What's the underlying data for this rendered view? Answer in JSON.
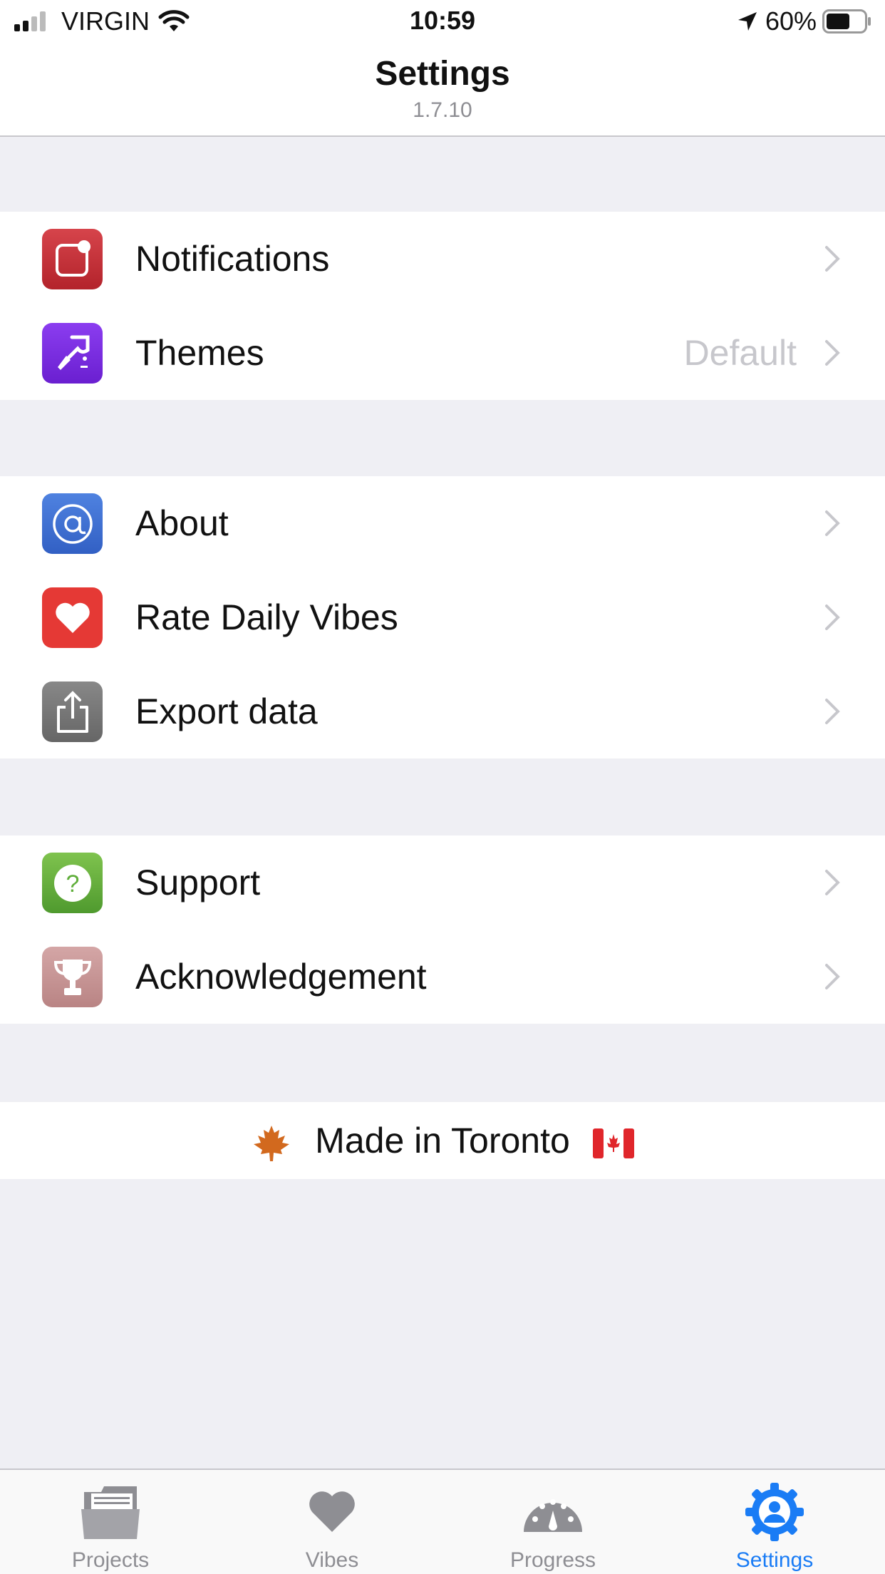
{
  "status_bar": {
    "carrier": "VIRGIN",
    "time": "10:59",
    "battery": "60%"
  },
  "nav": {
    "title": "Settings",
    "version": "1.7.10"
  },
  "sections": [
    {
      "rows": [
        {
          "label": "Notifications",
          "icon": "notification-badge-icon",
          "color": "#c62f36"
        },
        {
          "label": "Themes",
          "icon": "paintbrush-icon",
          "color": "#7b2ee0",
          "detail": "Default"
        }
      ]
    },
    {
      "rows": [
        {
          "label": "About",
          "icon": "at-sign-icon",
          "color": "#3f6fd1"
        },
        {
          "label": "Rate Daily Vibes",
          "icon": "heart-icon",
          "color": "#e53935"
        },
        {
          "label": "Export data",
          "icon": "share-icon",
          "color": "#7a7a7a"
        }
      ]
    },
    {
      "rows": [
        {
          "label": "Support",
          "icon": "question-icon",
          "color": "#5fae3a"
        },
        {
          "label": "Acknowledgement",
          "icon": "trophy-icon",
          "color": "#c9999a"
        }
      ]
    }
  ],
  "footer": {
    "text": "Made in Toronto"
  },
  "tabs": [
    {
      "label": "Projects",
      "icon": "folder-icon",
      "active": false
    },
    {
      "label": "Vibes",
      "icon": "heart-icon",
      "active": false
    },
    {
      "label": "Progress",
      "icon": "gauge-icon",
      "active": false
    },
    {
      "label": "Settings",
      "icon": "gear-person-icon",
      "active": true
    }
  ],
  "colors": {
    "accent": "#1a7cf5",
    "inactive_tab": "#8e8e93",
    "background": "#efeff4"
  }
}
